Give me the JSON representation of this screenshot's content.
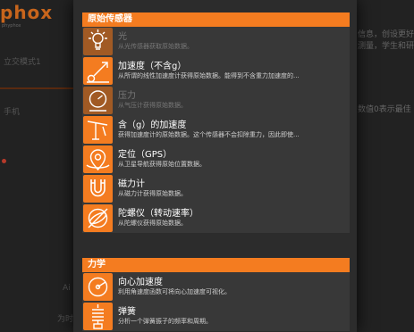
{
  "background": {
    "brand": "phox",
    "brand_sub": "phyphox",
    "right_lines": [
      "信息，创设更好",
      "测量，学生和研",
      "数值0表示最佳"
    ],
    "left_lines": [
      "立交模式1",
      "手机",
      "Ai",
      "为时"
    ]
  },
  "sections": [
    {
      "header": "原始传感器",
      "items": [
        {
          "title": "光",
          "desc": "从光传感器获取原始数据。",
          "icon": "lightbulb-icon",
          "disabled": true
        },
        {
          "title": "加速度（不含g）",
          "desc": "从所谓的线性加速度计获得原始数据。能得到不含重力加速度的...",
          "icon": "acceleration-icon",
          "disabled": false
        },
        {
          "title": "压力",
          "desc": "从气压计获得原始数据。",
          "icon": "pressure-gauge-icon",
          "disabled": true
        },
        {
          "title": "含（g）的加速度",
          "desc": "获得加速度计的原始数据。这个传感器不会扣除重力，因此即使...",
          "icon": "acceleration-g-icon",
          "disabled": false
        },
        {
          "title": "定位（GPS）",
          "desc": "从卫星导航获得原始位置数据。",
          "icon": "location-pin-icon",
          "disabled": false
        },
        {
          "title": "磁力计",
          "desc": "从磁力计获得原始数据。",
          "icon": "magnet-icon",
          "disabled": false
        },
        {
          "title": "陀螺仪（转动速率）",
          "desc": "从陀螺仪获得原始数据。",
          "icon": "gyroscope-icon",
          "disabled": false
        }
      ]
    },
    {
      "header": "力学",
      "items": [
        {
          "title": "向心加速度",
          "desc": "利用角速度函数可将向心加速度可视化。",
          "icon": "centripetal-icon",
          "disabled": false
        },
        {
          "title": "弹簧",
          "desc": "分析一个弹簧振子的频率和周期。",
          "icon": "spring-icon",
          "disabled": false
        }
      ]
    }
  ]
}
